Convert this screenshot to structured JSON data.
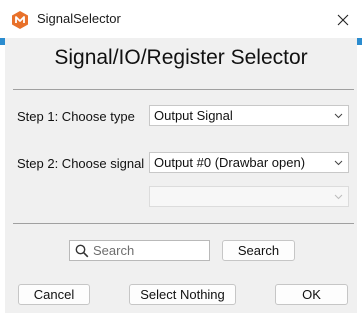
{
  "window": {
    "title": "SignalSelector"
  },
  "heading": "Signal/IO/Register Selector",
  "step1": {
    "label": "Step 1: Choose type",
    "value": "Output Signal"
  },
  "step2": {
    "label": "Step 2: Choose signal",
    "value": "Output #0 (Drawbar open)"
  },
  "step3": {
    "value": ""
  },
  "search": {
    "placeholder": "Search",
    "value": "",
    "button_label": "Search"
  },
  "buttons": {
    "cancel": "Cancel",
    "select_nothing": "Select Nothing",
    "ok": "OK"
  },
  "colors": {
    "accent": "#2b8ccf",
    "client_bg": "#f0f0f0",
    "icon_orange": "#e8712a"
  },
  "icons": {
    "app": "app-logo-icon",
    "close": "close-icon",
    "chevron": "chevron-down-icon",
    "search": "search-icon"
  }
}
